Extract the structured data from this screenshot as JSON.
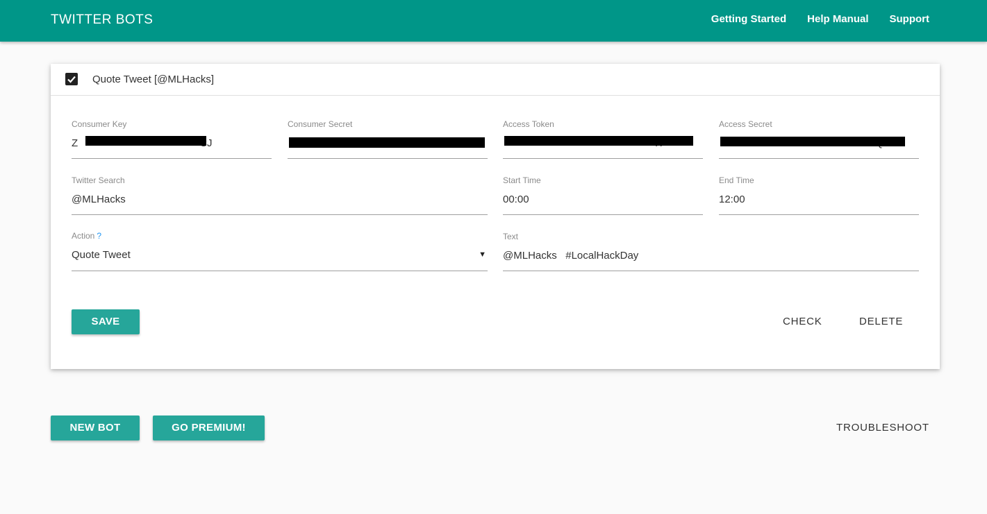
{
  "header": {
    "brand": "TWITTER BOTS",
    "links": [
      "Getting Started",
      "Help Manual",
      "Support"
    ]
  },
  "bot": {
    "enabled": true,
    "title": "Quote Tweet [@MLHacks]",
    "fields": {
      "consumer_key": {
        "label": "Consumer Key",
        "value": "Z                                          CJ"
      },
      "consumer_secret": {
        "label": "Consumer Secret",
        "value": ""
      },
      "access_token": {
        "label": "Access Token",
        "value": "                                                    TI"
      },
      "access_secret": {
        "label": "Access Secret",
        "value": "                                                    4Qi"
      },
      "twitter_search": {
        "label": "Twitter Search",
        "value": "@MLHacks"
      },
      "start_time": {
        "label": "Start Time",
        "value": "00:00"
      },
      "end_time": {
        "label": "End Time",
        "value": "12:00"
      },
      "action": {
        "label": "Action",
        "help": "?",
        "value": "Quote Tweet"
      },
      "text": {
        "label": "Text",
        "value": "@MLHacks   #LocalHackDay"
      }
    },
    "buttons": {
      "save": "SAVE",
      "check": "CHECK",
      "delete": "DELETE"
    }
  },
  "footer": {
    "new_bot": "NEW BOT",
    "go_premium": "GO PREMIUM!",
    "troubleshoot": "TROUBLESHOOT"
  },
  "colors": {
    "primary": "#009688",
    "button": "#26a69a",
    "help": "#2196f3"
  }
}
